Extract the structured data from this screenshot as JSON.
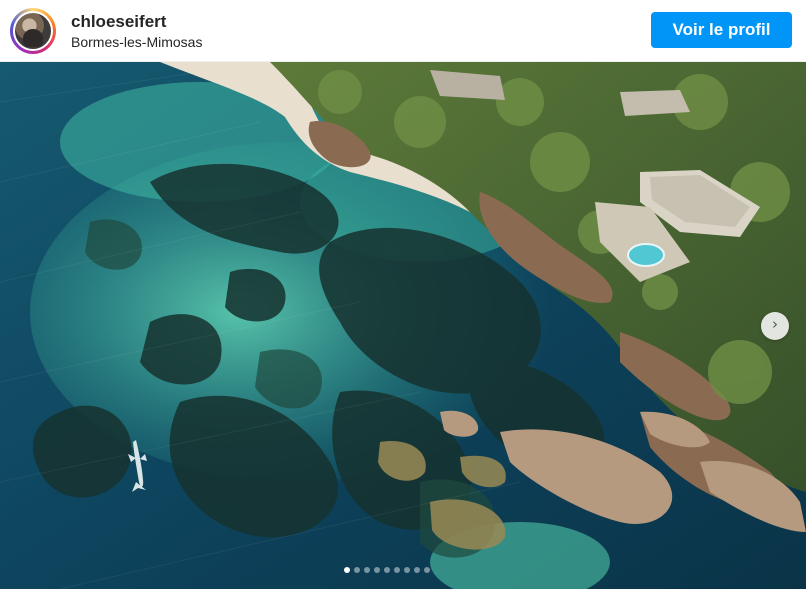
{
  "post": {
    "username": "chloeseifert",
    "location": "Bormes-les-Mimosas",
    "profile_button_label": "Voir le profil"
  },
  "carousel": {
    "total_slides": 9,
    "current_slide": 1,
    "next_icon": "chevron-right-icon"
  },
  "colors": {
    "accent": "#0095f6",
    "deep_sea": "#0d3b53",
    "shallow_turquoise": "#4cc3a6",
    "sand": "#e9dfcf"
  }
}
